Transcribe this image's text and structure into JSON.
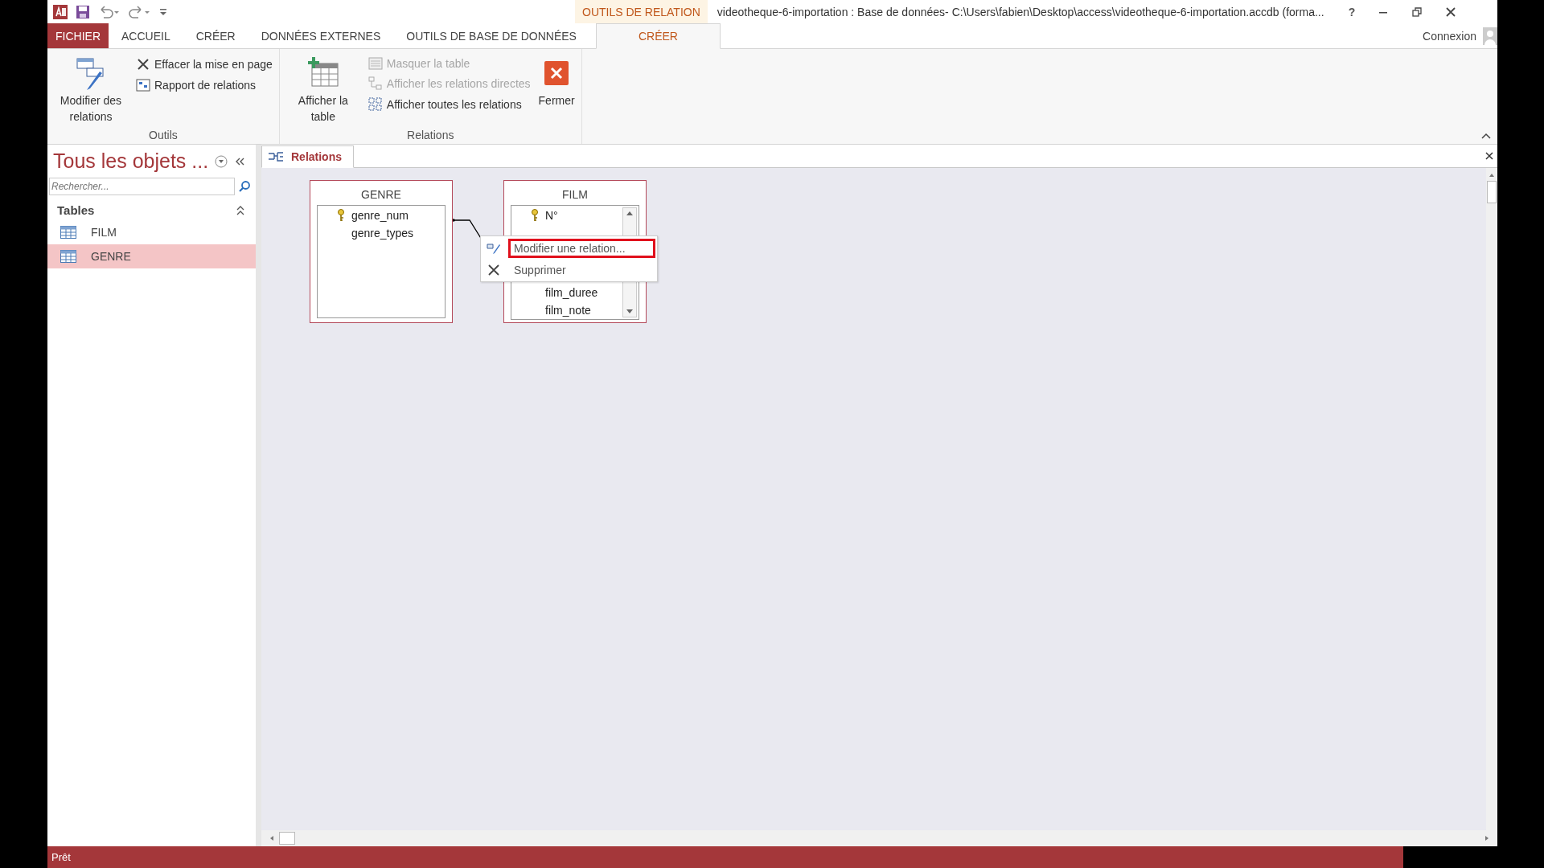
{
  "title_bar": {
    "contextual_group": "OUTILS DE RELATION",
    "title": "videotheque-6-importation : Base de données- C:\\Users\\fabien\\Desktop\\access\\videotheque-6-importation.accdb (forma...",
    "help": "?"
  },
  "ribbon_tabs": [
    {
      "label": "FICHIER",
      "kind": "file",
      "selected": false
    },
    {
      "label": "ACCUEIL",
      "kind": "normal",
      "selected": false
    },
    {
      "label": "CRÉER",
      "kind": "normal",
      "selected": false
    },
    {
      "label": "DONNÉES EXTERNES",
      "kind": "normal",
      "selected": false
    },
    {
      "label": "OUTILS DE BASE DE DONNÉES",
      "kind": "normal",
      "selected": false
    },
    {
      "label": "CRÉER",
      "kind": "contextual",
      "selected": true
    }
  ],
  "account": "Connexion",
  "ribbon_groups": [
    {
      "label": "Outils",
      "commands": [
        {
          "label": "Modifier des relations",
          "kind": "large",
          "disabled": false
        },
        {
          "label": "Effacer la mise en page",
          "kind": "small",
          "disabled": false
        },
        {
          "label": "Rapport de relations",
          "kind": "small",
          "disabled": false
        }
      ]
    },
    {
      "label": "Relations",
      "commands": [
        {
          "label": "Afficher la table",
          "kind": "large",
          "disabled": false
        },
        {
          "label": "Masquer la table",
          "kind": "small",
          "disabled": true
        },
        {
          "label": "Afficher les relations directes",
          "kind": "small",
          "disabled": true
        },
        {
          "label": "Afficher toutes les relations",
          "kind": "small",
          "disabled": false
        },
        {
          "label": "Fermer",
          "kind": "large",
          "disabled": false
        }
      ]
    }
  ],
  "nav_pane": {
    "title": "Tous les objets ...",
    "search": {
      "placeholder": "Rechercher..."
    },
    "groups": [
      {
        "label": "Tables",
        "items": [
          {
            "label": "FILM",
            "selected": false
          },
          {
            "label": "GENRE",
            "selected": true
          }
        ]
      }
    ]
  },
  "document_tabs": [
    {
      "label": "Relations",
      "selected": true
    }
  ],
  "tables": [
    {
      "name": "GENRE",
      "scrollbar": false,
      "fields": [
        {
          "name": "genre_num",
          "key": true
        },
        {
          "name": "genre_types",
          "key": false
        }
      ]
    },
    {
      "name": "FILM",
      "scrollbar": true,
      "fields": [
        {
          "name": "N°",
          "key": true
        },
        {
          "name": "film_duree",
          "key": false
        },
        {
          "name": "film_note",
          "key": false
        }
      ]
    }
  ],
  "context_menu": [
    {
      "label": "Modifier une relation...",
      "highlighted": true
    },
    {
      "label": "Supprimer",
      "highlighted": false
    }
  ],
  "status_bar": {
    "text": "Prêt"
  }
}
